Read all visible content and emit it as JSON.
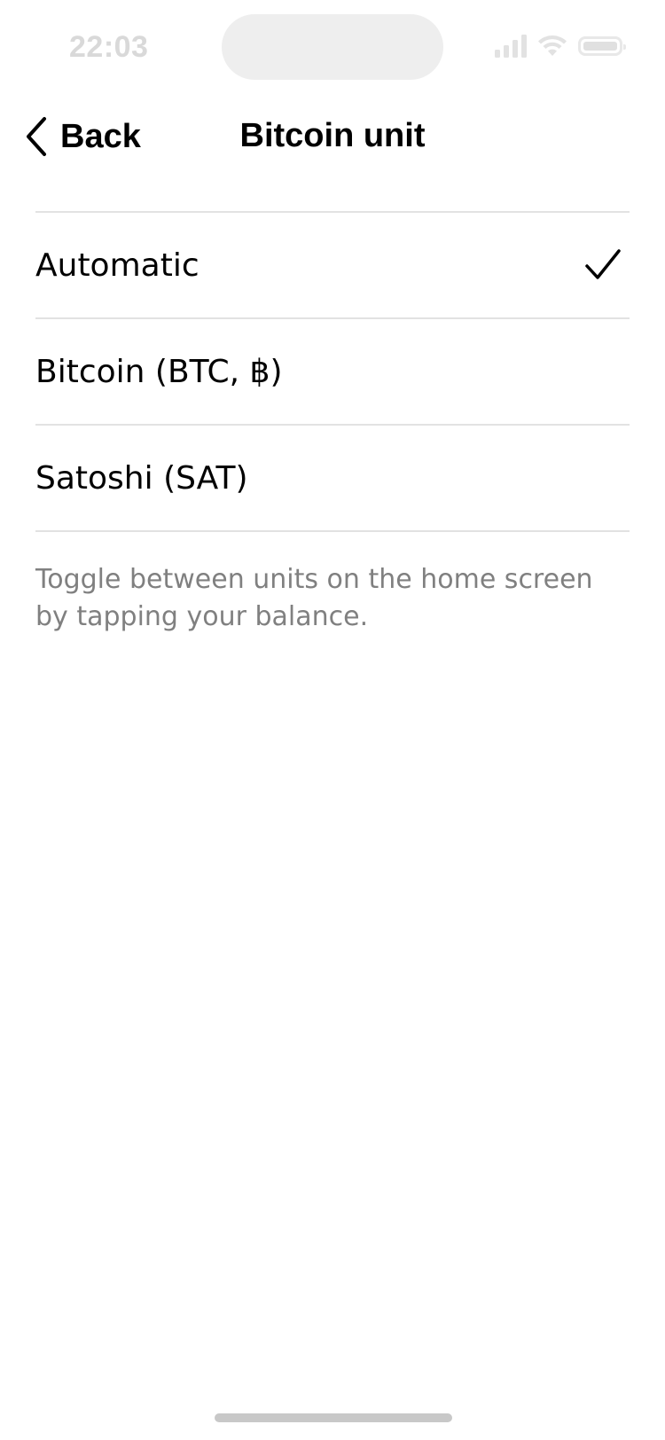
{
  "status_bar": {
    "time": "22:03",
    "icons": [
      "signal-icon",
      "wifi-icon",
      "battery-icon"
    ]
  },
  "nav": {
    "back_label": "Back",
    "back_icon": "chevron-left-icon",
    "title": "Bitcoin unit"
  },
  "options": [
    {
      "label": "Automatic",
      "selected": true
    },
    {
      "label": "Bitcoin (BTC, ฿)",
      "selected": false
    },
    {
      "label": "Satoshi (SAT)",
      "selected": false
    }
  ],
  "helper_text": "Toggle between units on the home screen by tapping your balance.",
  "colors": {
    "text": "#000000",
    "secondary_text": "#808080",
    "divider": "#e2e2e2",
    "status_muted": "#d9d9d9"
  }
}
